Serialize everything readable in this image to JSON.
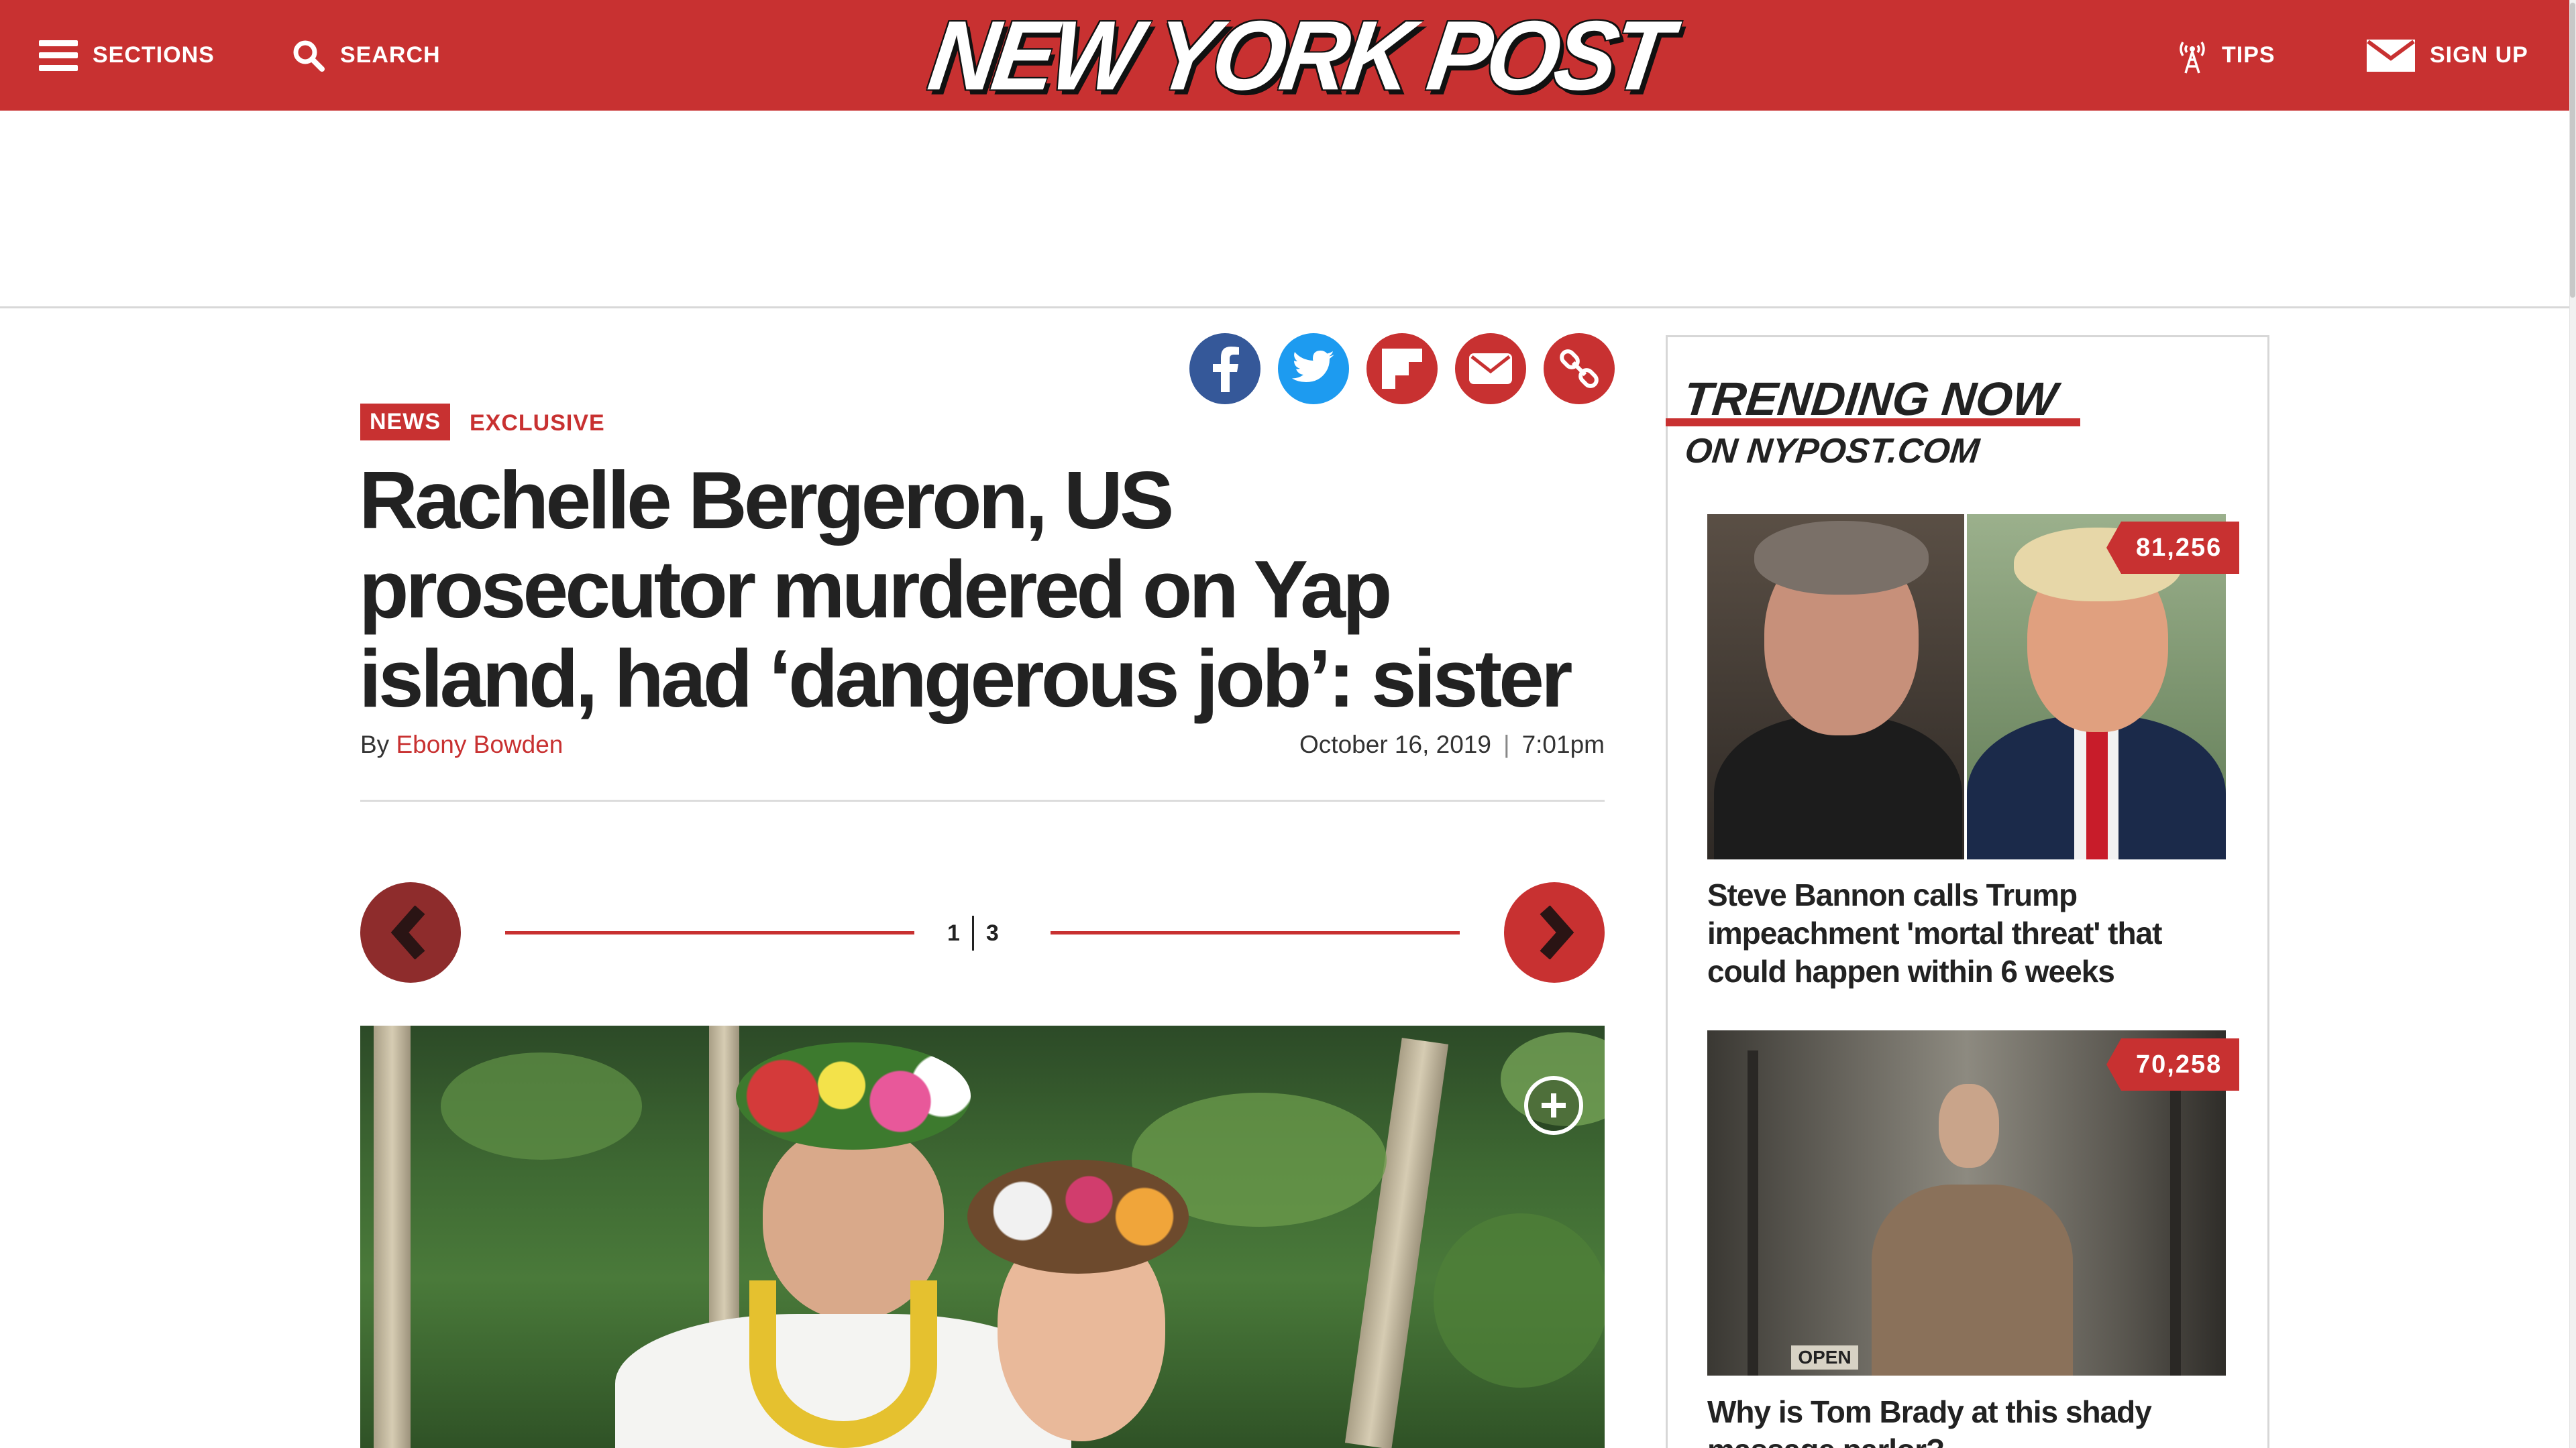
{
  "header": {
    "sections_label": "SECTIONS",
    "search_label": "SEARCH",
    "logo_text": "NEW YORK POST",
    "tips_label": "TIPS",
    "signup_label": "SIGN UP",
    "brand_color": "#c83131"
  },
  "share": {
    "icons": [
      "facebook-icon",
      "twitter-icon",
      "flipboard-icon",
      "email-icon",
      "link-icon"
    ]
  },
  "article": {
    "section": "NEWS",
    "kicker": "EXCLUSIVE",
    "headline_lines": [
      "Rachelle Bergeron, US",
      "prosecutor murdered on Yap",
      "island, had ‘dangerous job’: sister"
    ],
    "by_prefix": "By",
    "author": "Ebony Bowden",
    "date": "October 16, 2019",
    "time": "7:01pm"
  },
  "slideshow": {
    "current": "1",
    "total": "3"
  },
  "trending": {
    "title": "TRENDING NOW",
    "subtitle": "ON NYPOST.COM",
    "items": [
      {
        "count": "81,256",
        "title": "Steve Bannon calls Trump impeachment 'mortal threat' that could happen within 6 weeks"
      },
      {
        "count": "70,258",
        "title": "Why is Tom Brady at this shady massage parlor?",
        "image_sign": "OPEN"
      }
    ]
  }
}
